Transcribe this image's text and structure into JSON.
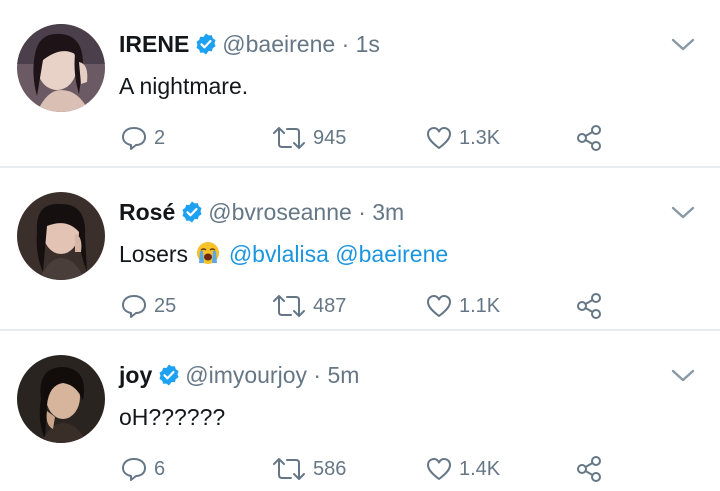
{
  "tweets": [
    {
      "name": "IRENE",
      "handle": "@baeirene",
      "separator": "·",
      "time": "1s",
      "text": "A nightmare.",
      "replies": "2",
      "retweets": "945",
      "likes": "1.3K"
    },
    {
      "name": "Rosé",
      "handle": "@bvroseanne",
      "separator": "·",
      "time": "3m",
      "text": "Losers",
      "emoji": "loudly-crying-face",
      "mentions": [
        "@bvlalisa",
        "@baeirene"
      ],
      "replies": "25",
      "retweets": "487",
      "likes": "1.1K"
    },
    {
      "name": "joy",
      "handle": "@imyourjoy",
      "separator": "·",
      "time": "5m",
      "text": "oH??????",
      "replies": "6",
      "retweets": "586",
      "likes": "1.4K"
    }
  ],
  "colors": {
    "verified": "#1da1f2",
    "mention": "#1b95e0",
    "muted": "#657786",
    "divider": "#e6ecf0"
  }
}
